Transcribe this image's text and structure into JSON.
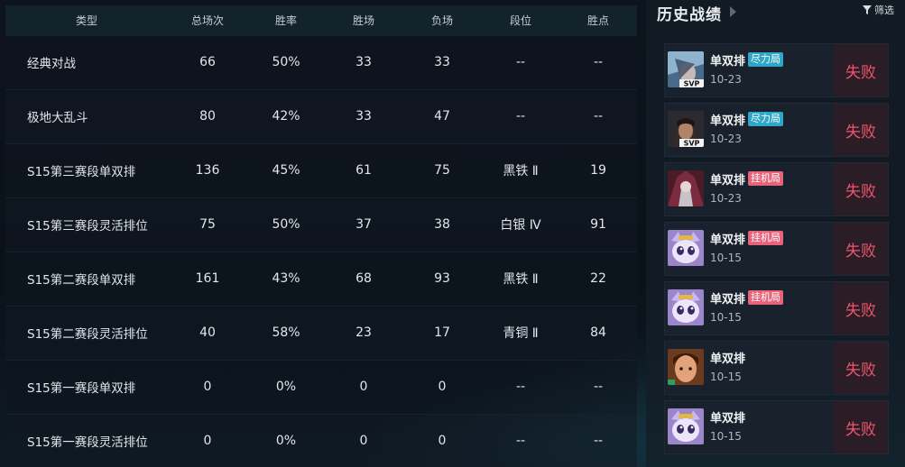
{
  "stats": {
    "headers": [
      "类型",
      "总场次",
      "胜率",
      "胜场",
      "负场",
      "段位",
      "胜点"
    ],
    "rows": [
      [
        "经典对战",
        "66",
        "50%",
        "33",
        "33",
        "--",
        "--"
      ],
      [
        "极地大乱斗",
        "80",
        "42%",
        "33",
        "47",
        "--",
        "--"
      ],
      [
        "S15第三赛段单双排",
        "136",
        "45%",
        "61",
        "75",
        "黑铁 Ⅱ",
        "19"
      ],
      [
        "S15第三赛段灵活排位",
        "75",
        "50%",
        "37",
        "38",
        "白银 Ⅳ",
        "91"
      ],
      [
        "S15第二赛段单双排",
        "161",
        "43%",
        "68",
        "93",
        "黑铁 Ⅱ",
        "22"
      ],
      [
        "S15第二赛段灵活排位",
        "40",
        "58%",
        "23",
        "17",
        "青铜 Ⅱ",
        "84"
      ],
      [
        "S15第一赛段单双排",
        "0",
        "0%",
        "0",
        "0",
        "--",
        "--"
      ],
      [
        "S15第一赛段灵活排位",
        "0",
        "0%",
        "0",
        "0",
        "--",
        "--"
      ]
    ]
  },
  "history": {
    "title": "历史战绩",
    "filter_label": "筛选",
    "colors": {
      "loss": "#f0556c",
      "tag_cyan": "#2ea7c8",
      "tag_pink": "#e8637a"
    },
    "matches": [
      {
        "mode": "单双排",
        "tag": "尽力局",
        "tag_color": "cyan",
        "date": "10-23",
        "result": "失败",
        "badge": "SVP",
        "avatar": "champion-1"
      },
      {
        "mode": "单双排",
        "tag": "尽力局",
        "tag_color": "cyan",
        "date": "10-23",
        "result": "失败",
        "badge": "SVP",
        "avatar": "champion-2"
      },
      {
        "mode": "单双排",
        "tag": "挂机局",
        "tag_color": "pink",
        "date": "10-23",
        "result": "失败",
        "badge": "",
        "avatar": "champion-3"
      },
      {
        "mode": "单双排",
        "tag": "挂机局",
        "tag_color": "pink",
        "date": "10-15",
        "result": "失败",
        "badge": "",
        "avatar": "yuumi"
      },
      {
        "mode": "单双排",
        "tag": "挂机局",
        "tag_color": "pink",
        "date": "10-15",
        "result": "失败",
        "badge": "",
        "avatar": "yuumi"
      },
      {
        "mode": "单双排",
        "tag": "",
        "tag_color": "",
        "date": "10-15",
        "result": "失败",
        "badge": "",
        "avatar": "champion-6"
      },
      {
        "mode": "单双排",
        "tag": "",
        "tag_color": "",
        "date": "10-15",
        "result": "失败",
        "badge": "",
        "avatar": "yuumi"
      }
    ]
  }
}
